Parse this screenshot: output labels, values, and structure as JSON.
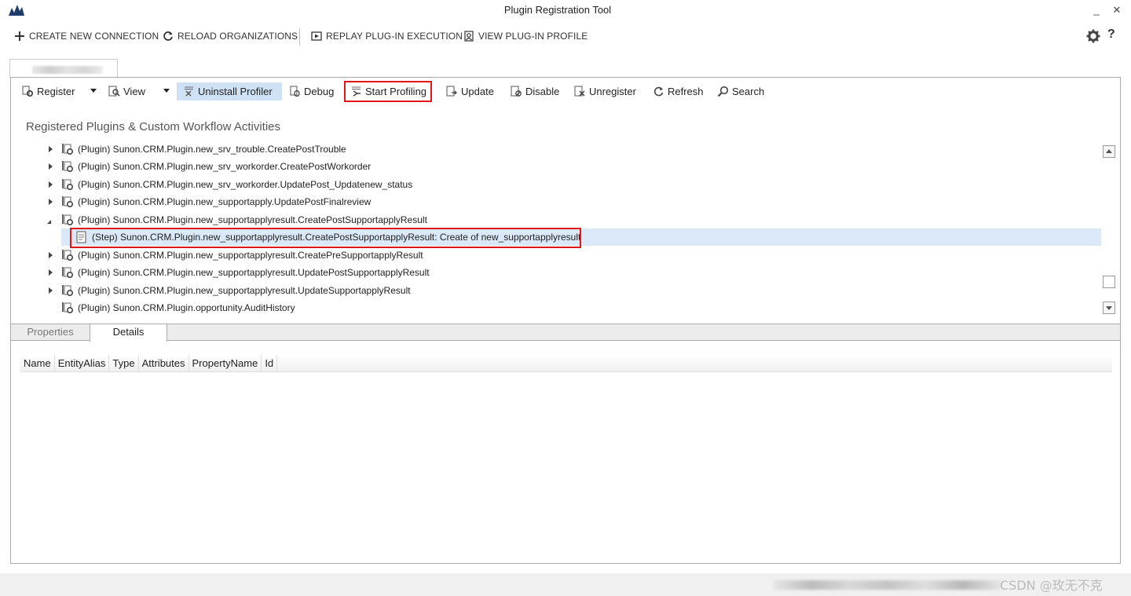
{
  "window": {
    "title": "Plugin Registration Tool",
    "minimize": "_",
    "close": "✕"
  },
  "cmdbar": {
    "create_new_connection": "CREATE NEW CONNECTION",
    "reload_organizations": "RELOAD ORGANIZATIONS",
    "replay_plugin_execution": "REPLAY PLUG-IN EXECUTION",
    "view_plugin_profile": "VIEW PLUG-IN PROFILE",
    "help": "?"
  },
  "toolbar": {
    "register": "Register",
    "view": "View",
    "uninstall_profiler": "Uninstall Profiler",
    "debug": "Debug",
    "start_profiling": "Start Profiling",
    "update": "Update",
    "disable": "Disable",
    "unregister": "Unregister",
    "refresh": "Refresh",
    "search": "Search"
  },
  "section_title": "Registered Plugins & Custom Workflow Activities",
  "tree": {
    "rows": [
      {
        "label": "(Plugin) Sunon.CRM.Plugin.new_srv_trouble.CreatePostTrouble",
        "state": "collapsed"
      },
      {
        "label": "(Plugin) Sunon.CRM.Plugin.new_srv_workorder.CreatePostWorkorder",
        "state": "collapsed"
      },
      {
        "label": "(Plugin) Sunon.CRM.Plugin.new_srv_workorder.UpdatePost_Updatenew_status",
        "state": "collapsed"
      },
      {
        "label": "(Plugin) Sunon.CRM.Plugin.new_supportapply.UpdatePostFinalreview",
        "state": "collapsed"
      },
      {
        "label": "(Plugin) Sunon.CRM.Plugin.new_supportapplyresult.CreatePostSupportapplyResult",
        "state": "expanded"
      },
      {
        "label": "(Step) Sunon.CRM.Plugin.new_supportapplyresult.CreatePostSupportapplyResult: Create of new_supportapplyresult",
        "state": "selected"
      },
      {
        "label": "(Plugin) Sunon.CRM.Plugin.new_supportapplyresult.CreatePreSupportapplyResult",
        "state": "collapsed"
      },
      {
        "label": "(Plugin) Sunon.CRM.Plugin.new_supportapplyresult.UpdatePostSupportapplyResult",
        "state": "collapsed"
      },
      {
        "label": "(Plugin) Sunon.CRM.Plugin.new_supportapplyresult.UpdateSupportapplyResult",
        "state": "collapsed"
      },
      {
        "label": "(Plugin) Sunon.CRM.Plugin.opportunity.AuditHistory",
        "state": "leaf"
      }
    ]
  },
  "bottom_tabs": {
    "properties": "Properties",
    "details": "Details"
  },
  "grid": {
    "columns": [
      "Name",
      "EntityAlias",
      "Type",
      "Attributes",
      "PropertyName",
      "Id"
    ]
  },
  "watermark": "CSDN @玫无不克",
  "colors": {
    "highlight_red": "#e0161b",
    "selection_blue": "#dbe8f7",
    "active_button": "#cfe2f5"
  }
}
